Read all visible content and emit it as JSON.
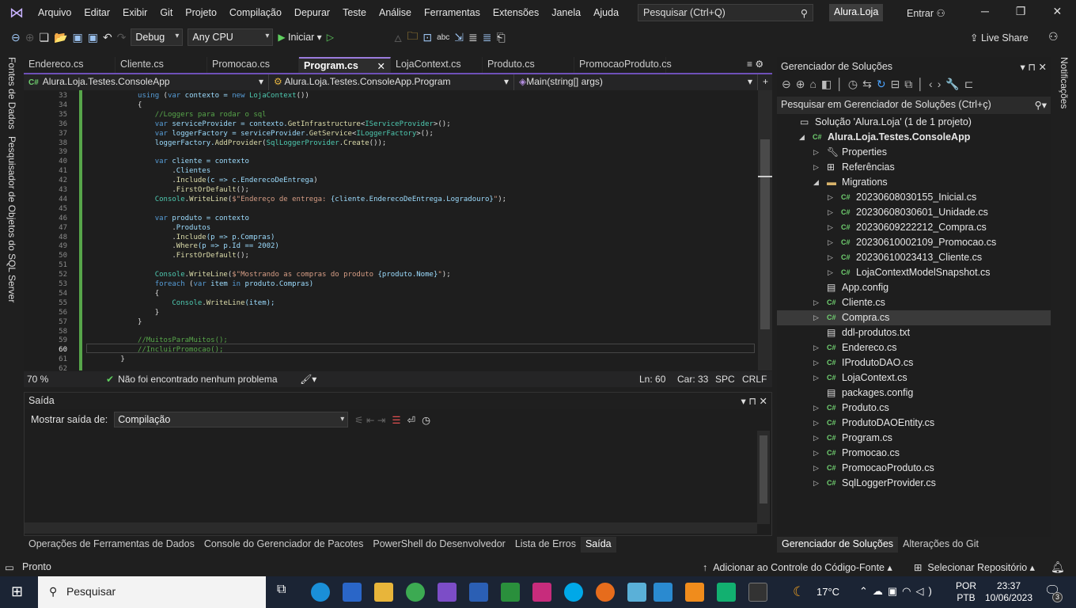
{
  "menu": {
    "items": [
      "Arquivo",
      "Editar",
      "Exibir",
      "Git",
      "Projeto",
      "Compilação",
      "Depurar",
      "Teste",
      "Análise",
      "Ferramentas",
      "Extensões",
      "Janela",
      "Ajuda"
    ],
    "search_placeholder": "Pesquisar (Ctrl+Q)",
    "solution_name": "Alura.Loja",
    "signin": "Entrar"
  },
  "toolbar": {
    "config": "Debug",
    "platform": "Any CPU",
    "start": "Iniciar",
    "live_share": "Live Share"
  },
  "left_strip": [
    "Fontes de Dados",
    "Pesquisador de Objetos do SQL Server"
  ],
  "right_strip": "Notificações",
  "tabs": [
    {
      "label": "Endereco.cs"
    },
    {
      "label": "Cliente.cs"
    },
    {
      "label": "Promocao.cs"
    },
    {
      "label": "Program.cs",
      "active": true
    },
    {
      "label": "LojaContext.cs"
    },
    {
      "label": "Produto.cs"
    },
    {
      "label": "PromocaoProduto.cs"
    }
  ],
  "navbar": {
    "project": "Alura.Loja.Testes.ConsoleApp",
    "class": "Alura.Loja.Testes.ConsoleApp.Program",
    "member": "Main(string[] args)"
  },
  "code": [
    {
      "n": "33",
      "t": [
        [
          "            ",
          "pl"
        ],
        [
          "using",
          "kw"
        ],
        [
          " (",
          "pl"
        ],
        [
          "var",
          "kw"
        ],
        [
          " contexto = ",
          "id"
        ],
        [
          "new",
          "kw"
        ],
        [
          " ",
          "pl"
        ],
        [
          "LojaContext",
          "ty"
        ],
        [
          "())",
          "pl"
        ]
      ]
    },
    {
      "n": "34",
      "t": [
        [
          "            {",
          "pl"
        ]
      ]
    },
    {
      "n": "35",
      "t": [
        [
          "                ",
          "pl"
        ],
        [
          "//Loggers para rodar o sql",
          "cm"
        ]
      ]
    },
    {
      "n": "36",
      "t": [
        [
          "                ",
          "pl"
        ],
        [
          "var",
          "kw"
        ],
        [
          " serviceProvider = contexto.",
          "id"
        ],
        [
          "GetInfrastructure",
          "mt"
        ],
        [
          "<",
          "pl"
        ],
        [
          "IServiceProvider",
          "ty"
        ],
        [
          ">();",
          "pl"
        ]
      ]
    },
    {
      "n": "37",
      "t": [
        [
          "                ",
          "pl"
        ],
        [
          "var",
          "kw"
        ],
        [
          " loggerFactory = serviceProvider.",
          "id"
        ],
        [
          "GetService",
          "mt"
        ],
        [
          "<",
          "pl"
        ],
        [
          "ILoggerFactory",
          "ty"
        ],
        [
          ">();",
          "pl"
        ]
      ]
    },
    {
      "n": "38",
      "t": [
        [
          "                loggerFactory.",
          "id"
        ],
        [
          "AddProvider",
          "mt"
        ],
        [
          "(",
          "pl"
        ],
        [
          "SqlLoggerProvider",
          "ty"
        ],
        [
          ".",
          "pl"
        ],
        [
          "Create",
          "mt"
        ],
        [
          "());",
          "pl"
        ]
      ]
    },
    {
      "n": "39",
      "t": []
    },
    {
      "n": "40",
      "t": [
        [
          "                ",
          "pl"
        ],
        [
          "var",
          "kw"
        ],
        [
          " cliente = contexto",
          "id"
        ]
      ]
    },
    {
      "n": "41",
      "t": [
        [
          "                    .",
          "pl"
        ],
        [
          "Clientes",
          "id"
        ]
      ]
    },
    {
      "n": "42",
      "t": [
        [
          "                    .",
          "pl"
        ],
        [
          "Include",
          "mt"
        ],
        [
          "(c => c.",
          "id"
        ],
        [
          "EnderecoDeEntrega",
          "id"
        ],
        [
          ")",
          "pl"
        ]
      ]
    },
    {
      "n": "43",
      "t": [
        [
          "                    .",
          "pl"
        ],
        [
          "FirstOrDefault",
          "mt"
        ],
        [
          "();",
          "pl"
        ]
      ]
    },
    {
      "n": "44",
      "t": [
        [
          "                ",
          "pl"
        ],
        [
          "Console",
          "ty"
        ],
        [
          ".",
          "pl"
        ],
        [
          "WriteLine",
          "mt"
        ],
        [
          "(",
          "pl"
        ],
        [
          "$\"Endereço de entrega: ",
          "st"
        ],
        [
          "{cliente.EnderecoDeEntrega.Logradouro}",
          "id"
        ],
        [
          "\"",
          "st"
        ],
        [
          ");",
          "pl"
        ]
      ]
    },
    {
      "n": "45",
      "t": []
    },
    {
      "n": "46",
      "t": [
        [
          "                ",
          "pl"
        ],
        [
          "var",
          "kw"
        ],
        [
          " produto = contexto",
          "id"
        ]
      ]
    },
    {
      "n": "47",
      "t": [
        [
          "                    .",
          "pl"
        ],
        [
          "Produtos",
          "id"
        ]
      ]
    },
    {
      "n": "48",
      "t": [
        [
          "                    .",
          "pl"
        ],
        [
          "Include",
          "mt"
        ],
        [
          "(p => p.Compras)",
          "id"
        ]
      ]
    },
    {
      "n": "49",
      "t": [
        [
          "                    .",
          "pl"
        ],
        [
          "Where",
          "mt"
        ],
        [
          "(p => p.Id == 2002)",
          "id"
        ]
      ]
    },
    {
      "n": "50",
      "t": [
        [
          "                    .",
          "pl"
        ],
        [
          "FirstOrDefault",
          "mt"
        ],
        [
          "();",
          "pl"
        ]
      ]
    },
    {
      "n": "51",
      "t": []
    },
    {
      "n": "52",
      "t": [
        [
          "                ",
          "pl"
        ],
        [
          "Console",
          "ty"
        ],
        [
          ".",
          "pl"
        ],
        [
          "WriteLine",
          "mt"
        ],
        [
          "(",
          "pl"
        ],
        [
          "$\"Mostrando as compras do produto ",
          "st"
        ],
        [
          "{produto.Nome}",
          "id"
        ],
        [
          "\"",
          "st"
        ],
        [
          ");",
          "pl"
        ]
      ]
    },
    {
      "n": "53",
      "t": [
        [
          "                ",
          "pl"
        ],
        [
          "foreach",
          "kw"
        ],
        [
          " (",
          "pl"
        ],
        [
          "var",
          "kw"
        ],
        [
          " item ",
          "id"
        ],
        [
          "in",
          "kw"
        ],
        [
          " produto.Compras)",
          "id"
        ]
      ]
    },
    {
      "n": "54",
      "t": [
        [
          "                {",
          "pl"
        ]
      ]
    },
    {
      "n": "55",
      "t": [
        [
          "                    ",
          "pl"
        ],
        [
          "Console",
          "ty"
        ],
        [
          ".",
          "pl"
        ],
        [
          "WriteLine",
          "mt"
        ],
        [
          "(item);",
          "id"
        ]
      ]
    },
    {
      "n": "56",
      "t": [
        [
          "                }",
          "pl"
        ]
      ]
    },
    {
      "n": "57",
      "t": [
        [
          "            }",
          "pl"
        ]
      ]
    },
    {
      "n": "58",
      "t": []
    },
    {
      "n": "59",
      "t": [
        [
          "            ",
          "pl"
        ],
        [
          "//MuitosParaMuitos();",
          "cm"
        ]
      ]
    },
    {
      "n": "60",
      "t": [
        [
          "            ",
          "pl"
        ],
        [
          "//IncluirPromocao();",
          "cm"
        ]
      ]
    },
    {
      "n": "61",
      "t": [
        [
          "        }",
          "pl"
        ]
      ]
    },
    {
      "n": "62",
      "t": []
    }
  ],
  "editor_status": {
    "zoom": "70 %",
    "issues": "Não foi encontrado nenhum problema",
    "line": "Ln: 60",
    "col": "Car: 33",
    "spc": "SPC",
    "eol": "CRLF"
  },
  "output": {
    "title": "Saída",
    "show_from_label": "Mostrar saída de:",
    "show_from_value": "Compilação"
  },
  "bottom_tabs": [
    {
      "label": "Operações de Ferramentas de Dados"
    },
    {
      "label": "Console do Gerenciador de Pacotes"
    },
    {
      "label": "PowerShell do Desenvolvedor"
    },
    {
      "label": "Lista de Erros"
    },
    {
      "label": "Saída",
      "active": true
    }
  ],
  "solution_explorer": {
    "title": "Gerenciador de Soluções",
    "search_placeholder": "Pesquisar em Gerenciador de Soluções (Ctrl+ç)",
    "items": [
      {
        "label": "Solução 'Alura.Loja' (1 de 1 projeto)",
        "level": 0,
        "icon": "solution-icon"
      },
      {
        "label": "Alura.Loja.Testes.ConsoleApp",
        "level": 1,
        "icon": "csproj-icon",
        "expanded": true,
        "bold": true
      },
      {
        "label": "Properties",
        "level": 2,
        "icon": "wrench-icon",
        "collapsed": true
      },
      {
        "label": "Referências",
        "level": 2,
        "icon": "references-icon",
        "collapsed": true
      },
      {
        "label": "Migrations",
        "level": 2,
        "icon": "folder-icon",
        "expanded": true
      },
      {
        "label": "20230608030155_Inicial.cs",
        "level": 3,
        "icon": "cs-icon",
        "collapsed": true
      },
      {
        "label": "20230608030601_Unidade.cs",
        "level": 3,
        "icon": "cs-icon",
        "collapsed": true
      },
      {
        "label": "20230609222212_Compra.cs",
        "level": 3,
        "icon": "cs-icon",
        "collapsed": true
      },
      {
        "label": "20230610002109_Promocao.cs",
        "level": 3,
        "icon": "cs-icon",
        "collapsed": true
      },
      {
        "label": "20230610023413_Cliente.cs",
        "level": 3,
        "icon": "cs-icon",
        "collapsed": true
      },
      {
        "label": "LojaContextModelSnapshot.cs",
        "level": 3,
        "icon": "cs-icon",
        "collapsed": true
      },
      {
        "label": "App.config",
        "level": 2,
        "icon": "config-icon"
      },
      {
        "label": "Cliente.cs",
        "level": 2,
        "icon": "cs-icon",
        "collapsed": true
      },
      {
        "label": "Compra.cs",
        "level": 2,
        "icon": "cs-icon",
        "collapsed": true,
        "selected": true
      },
      {
        "label": "ddl-produtos.txt",
        "level": 2,
        "icon": "text-file-icon"
      },
      {
        "label": "Endereco.cs",
        "level": 2,
        "icon": "cs-icon",
        "collapsed": true
      },
      {
        "label": "IProdutoDAO.cs",
        "level": 2,
        "icon": "cs-icon",
        "collapsed": true
      },
      {
        "label": "LojaContext.cs",
        "level": 2,
        "icon": "cs-icon",
        "collapsed": true
      },
      {
        "label": "packages.config",
        "level": 2,
        "icon": "config-icon"
      },
      {
        "label": "Produto.cs",
        "level": 2,
        "icon": "cs-icon",
        "collapsed": true
      },
      {
        "label": "ProdutoDAOEntity.cs",
        "level": 2,
        "icon": "cs-icon",
        "collapsed": true
      },
      {
        "label": "Program.cs",
        "level": 2,
        "icon": "cs-icon",
        "collapsed": true
      },
      {
        "label": "Promocao.cs",
        "level": 2,
        "icon": "cs-icon",
        "collapsed": true
      },
      {
        "label": "PromocaoProduto.cs",
        "level": 2,
        "icon": "cs-icon",
        "collapsed": true
      },
      {
        "label": "SqlLoggerProvider.cs",
        "level": 2,
        "icon": "cs-icon",
        "collapsed": true
      }
    ],
    "tabs": [
      {
        "label": "Gerenciador de Soluções",
        "active": true
      },
      {
        "label": "Alterações do Git"
      }
    ]
  },
  "statusbar": {
    "state": "Pronto",
    "source_control": "Adicionar ao Controle do Código-Fonte",
    "repo": "Selecionar Repositório"
  },
  "taskbar": {
    "search": "Pesquisar",
    "temp": "17°C",
    "lang1": "POR",
    "lang2": "PTB",
    "time": "23:37",
    "date": "10/06/2023",
    "notif_count": "3"
  },
  "colors": {
    "accent": "#9b7cde",
    "editor_bg": "#1e1e1e",
    "taskbar": "#1b2434"
  }
}
